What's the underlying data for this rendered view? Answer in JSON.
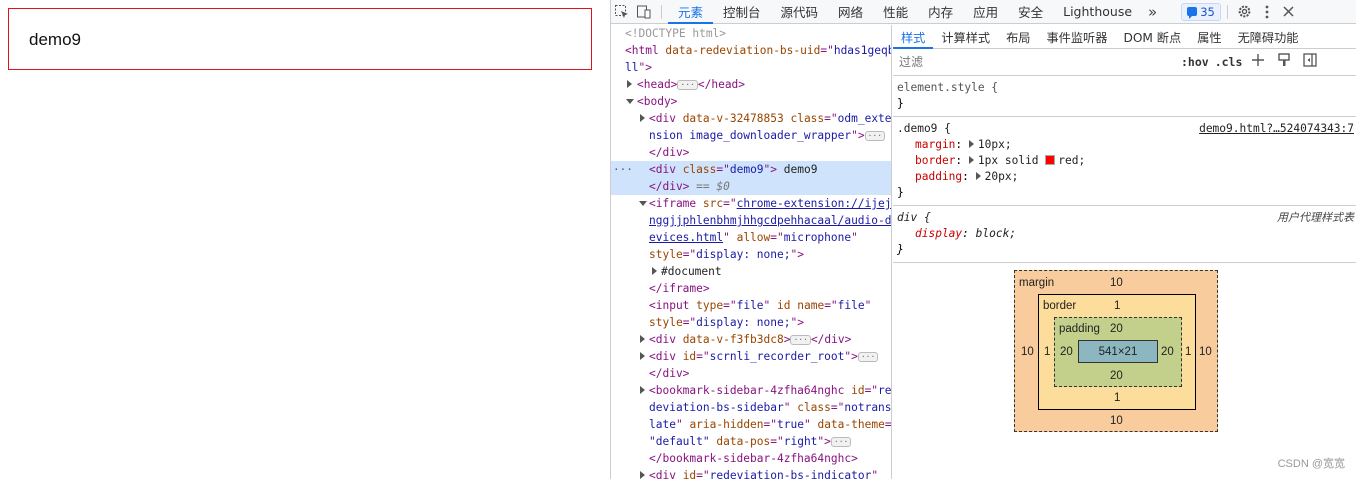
{
  "page": {
    "demo_text": "demo9"
  },
  "devtools": {
    "tabs": [
      "元素",
      "控制台",
      "源代码",
      "网络",
      "性能",
      "内存",
      "应用",
      "安全",
      "Lighthouse"
    ],
    "more": "»",
    "issues_count": "35",
    "elements": {
      "l1": "<!DOCTYPE html>",
      "l2_a": "<html ",
      "l2_an": "data-redeviation-bs-uid",
      "l2_eq": "=\"",
      "l2_av": "hdas1geqb",
      "l3_av": "ll",
      "l3_b": "\">",
      "l4_a": "<head>",
      "l4_b": "</head>",
      "l5": "<body>",
      "l6_a": "<div ",
      "l6_an1": "data-v-32478853",
      "l6_an2": " class",
      "l6_eq": "=\"",
      "l6_av": "odm_exte",
      "l7_av": "nsion image_downloader_wrapper",
      "l7_b": "\">",
      "l8": "</div>",
      "l9_a": "<div ",
      "l9_an": "class",
      "l9_eq": "=\"",
      "l9_av": "demo9",
      "l9_b": "\">",
      "l9_txt": " demo9",
      "l10_a": "</div>",
      "l10_b": " == $0",
      "l11_a": "<iframe ",
      "l11_an": "src",
      "l11_eq": "=\"",
      "l11_av": "chrome-extension://ijej",
      "l12_av": "nggjjphlenbhmjhhgcdpehhacaal/audio-d",
      "l13_av": "evices.html",
      "l13_b": "\" ",
      "l13_an": "allow",
      "l13_eq": "=\"",
      "l13_av2": "microphone",
      "l13_c": "\"",
      "l14_an": "style",
      "l14_eq": "=\"",
      "l14_av": "display: none;",
      "l14_b": "\">",
      "l15": "#document",
      "l16": "</iframe>",
      "l17_a": "<input ",
      "l17_an1": "type",
      "l17_eq1": "=\"",
      "l17_av1": "file",
      "l17_b": "\" ",
      "l17_an2": "id name",
      "l17_eq2": "=\"",
      "l17_av2": "file",
      "l17_c": "\"",
      "l18_an": "style",
      "l18_eq": "=\"",
      "l18_av": "display: none;",
      "l18_b": "\">",
      "l19_a": "<div ",
      "l19_an": "data-v-f3fb3dc8",
      "l19_b": ">",
      "l19_c": "</div>",
      "l20_a": "<div ",
      "l20_an": "id",
      "l20_eq": "=\"",
      "l20_av": "scrnli_recorder_root",
      "l20_b": "\">",
      "l21": "</div>",
      "l22_a": "<bookmark-sidebar-4zfha64nghc ",
      "l22_an": "id",
      "l22_eq": "=\"",
      "l22_av": "re",
      "l23_av": "deviation-bs-sidebar",
      "l23_b": "\" ",
      "l23_an": "class",
      "l23_eq": "=\"",
      "l23_av2": "notrans",
      "l24_av": "late",
      "l24_b": "\" ",
      "l24_an": "aria-hidden",
      "l24_eq": "=\"",
      "l24_av2": "true",
      "l24_c": "\" ",
      "l24_an2": "data-theme",
      "l24_eq2": "=",
      "l25_av": "\"default\"",
      "l25_an": " data-pos",
      "l25_eq": "=\"",
      "l25_av2": "right",
      "l25_b": "\">",
      "l26": "</bookmark-sidebar-4zfha64nghc>",
      "l27_a": "<div ",
      "l27_an": "id",
      "l27_eq": "=\"",
      "l27_av": "redeviation-bs-indicator",
      "l27_b": "\""
    },
    "styles": {
      "subtabs": [
        "样式",
        "计算样式",
        "布局",
        "事件监听器",
        "DOM 断点",
        "属性",
        "无障碍功能"
      ],
      "filter_placeholder": "过滤",
      "hov": ":hov",
      "cls": ".cls",
      "element_style": "element.style {",
      "close": "}",
      "demo_selector": ".demo9 {",
      "demo_source": "demo9.html?…524074343:7",
      "margin_prop": "margin",
      "margin_val": "10px;",
      "border_prop": "border",
      "border_val_a": "1px solid ",
      "border_val_b": "red;",
      "padding_prop": "padding",
      "padding_val": "20px;",
      "colon": ":",
      "div_selector": "div {",
      "ua_label": "用户代理样式表",
      "display_prop": "display",
      "display_val": "block;"
    },
    "boxmodel": {
      "margin_label": "margin",
      "margin_top": "10",
      "margin_bottom": "10",
      "margin_left": "10",
      "margin_right": "10",
      "border_label": "border",
      "border_top": "1",
      "border_bottom": "1",
      "border_left": "1",
      "border_right": "1",
      "padding_label": "padding",
      "padding_top": "20",
      "padding_bottom": "20",
      "padding_left": "20",
      "padding_right": "20",
      "content": "541×21"
    },
    "watermark": "CSDN @宽宽"
  }
}
